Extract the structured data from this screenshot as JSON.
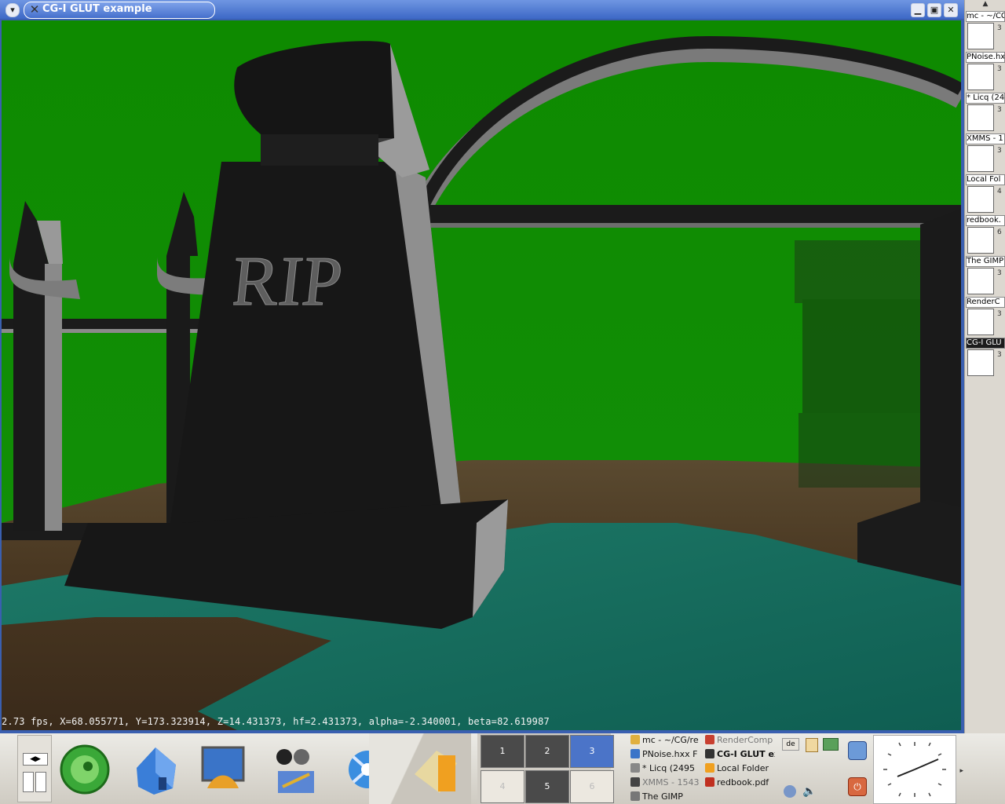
{
  "window": {
    "title": "CG-I GLUT example",
    "status_line": "2.73 fps,  X=68.055771, Y=173.323914, Z=14.431373, hf=2.431373, alpha=-2.340001, beta=82.619987",
    "engraving": "RIP",
    "buttons": [
      "minimize",
      "maximize",
      "close"
    ]
  },
  "right_tasks": [
    {
      "label": "mc - ~/CG",
      "num": "3",
      "icon": "folder-icon"
    },
    {
      "label": "PNoise.hx",
      "num": "3",
      "icon": "editor-icon"
    },
    {
      "label": "* Licq (24",
      "num": "3",
      "icon": "computer-icon"
    },
    {
      "label": "XMMS - 1",
      "num": "3",
      "icon": "headphones-icon"
    },
    {
      "label": "Local Fol",
      "num": "4",
      "icon": "mail-icon"
    },
    {
      "label": "redbook.",
      "num": "6",
      "icon": "document-icon"
    },
    {
      "label": "The GIMP",
      "num": "3",
      "icon": "gimp-icon"
    },
    {
      "label": "RenderC",
      "num": "3",
      "icon": "render-icon"
    },
    {
      "label": "CG-I GLU",
      "num": "3",
      "icon": "x-icon"
    }
  ],
  "pager": [
    "1",
    "2",
    "3",
    "4",
    "5",
    "6"
  ],
  "pager_active": "3",
  "tasklist": [
    {
      "label": "mc - ~/CG/re",
      "icon": "folder-icon"
    },
    {
      "label": "RenderComp",
      "icon": "render-icon"
    },
    {
      "label": "PNoise.hxx F",
      "icon": "editor-icon"
    },
    {
      "label": "CG-I GLUT ex",
      "icon": "x-icon"
    },
    {
      "label": "* Licq (2495",
      "icon": "computer-icon"
    },
    {
      "label": "Local Folder",
      "icon": "mail-icon"
    },
    {
      "label": "XMMS - 1543",
      "icon": "headphones-icon"
    },
    {
      "label": "redbook.pdf",
      "icon": "pdf-icon"
    },
    {
      "label": "The GIMP",
      "icon": "gimp-icon"
    }
  ],
  "tray": {
    "keyboard_layout": "de"
  },
  "colors": {
    "sky": "#108c00",
    "title_blue": "#4a74cc",
    "pager_active": "#4b74c8",
    "stone": "#171717"
  }
}
